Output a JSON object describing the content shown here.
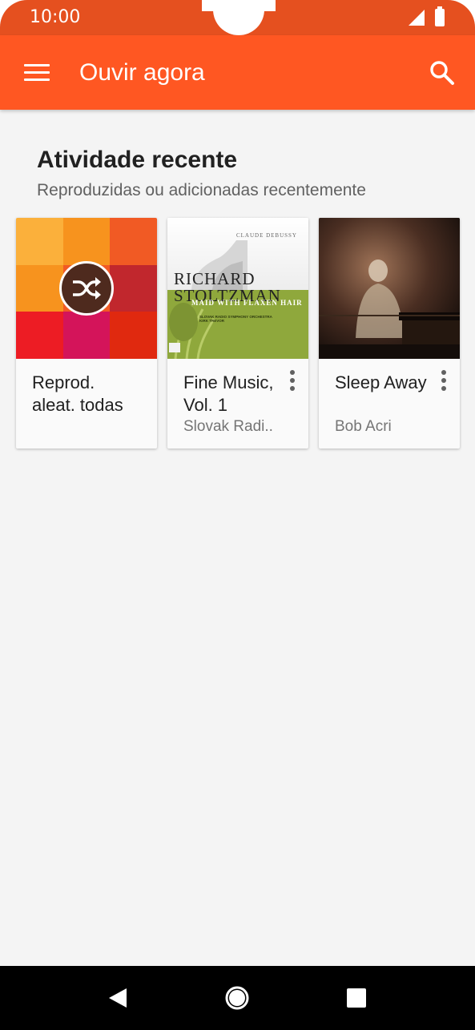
{
  "status_bar": {
    "time": "10:00"
  },
  "app_bar": {
    "title": "Ouvir agora"
  },
  "section": {
    "title": "Atividade recente",
    "subtitle": "Reproduzidas ou adicionadas recentemente"
  },
  "cards": [
    {
      "title": "Reprod. aleat. todas",
      "subtitle": "",
      "art": "shuffle-mosaic"
    },
    {
      "title": "Fine Music, Vol. 1",
      "subtitle": "Slovak Radi..",
      "art": "album-art",
      "art_text": {
        "composer": "CLAUDE DEBUSSY",
        "artist_line1": "RICHARD",
        "artist_line2": "STOLTZMAN",
        "album": "MAID WITH FLAXEN HAIR",
        "credits_line1": "SLOVAK RADIO SYMPHONY ORCHESTRA",
        "credits_line2": "KIRK TREVOR"
      }
    },
    {
      "title": "Sleep Away",
      "subtitle": "Bob Acri",
      "art": "album-art"
    }
  ],
  "colors": {
    "accent": "#ff5722",
    "status_bar": "#e5501f",
    "background": "#f4f4f4",
    "nav_bar": "#000000"
  },
  "nav_bar": {
    "icons": [
      "back-icon",
      "home-icon",
      "recents-icon"
    ]
  }
}
